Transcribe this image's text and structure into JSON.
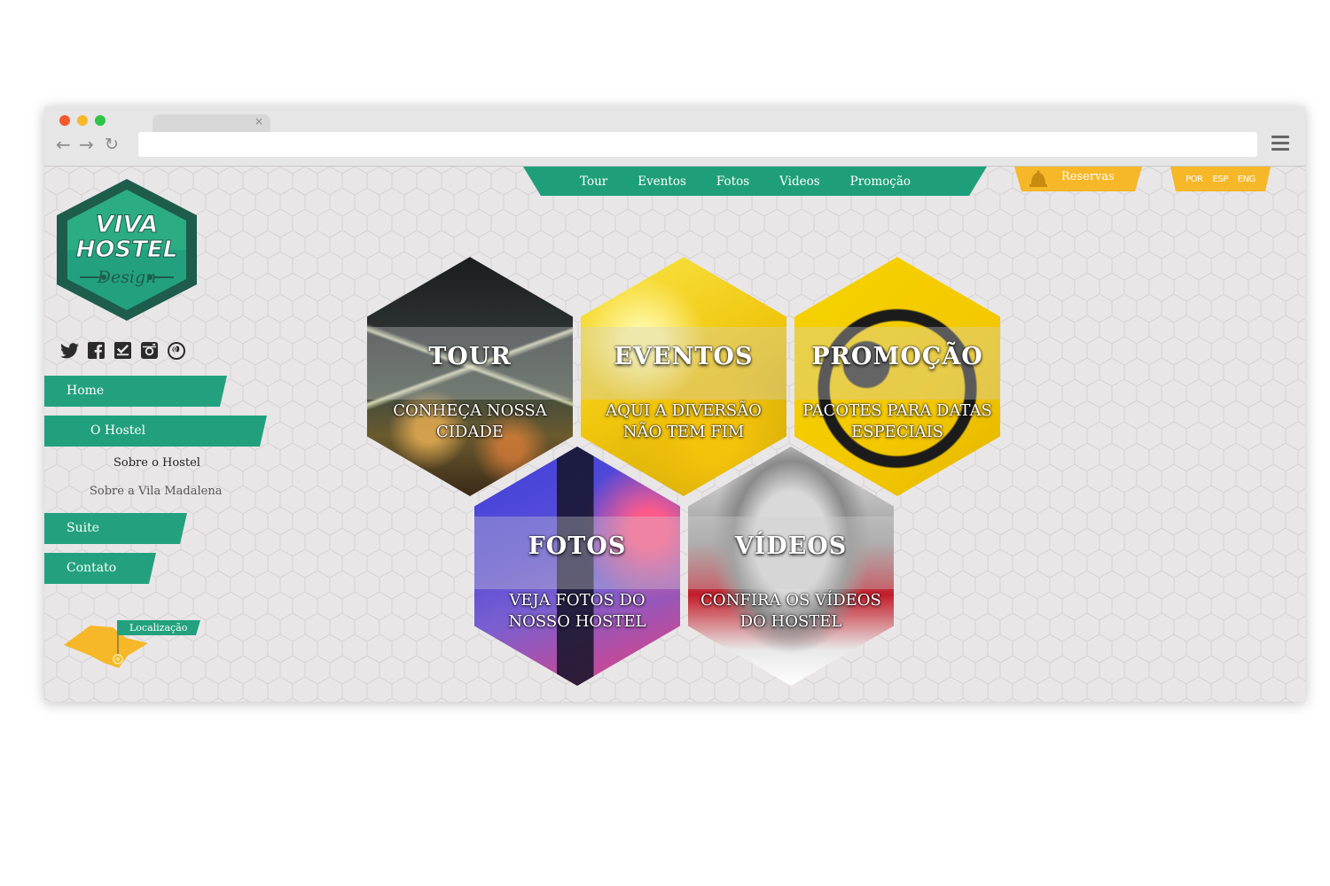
{
  "browser": {
    "tab_close": "×",
    "back": "←",
    "forward": "→",
    "reload": "↻",
    "url": ""
  },
  "logo": {
    "line1": "VIVA",
    "line2": "HOSTEL",
    "line3": "Design",
    "color_primary": "#23a17e",
    "color_dark": "#1e5c4c"
  },
  "social": [
    "twitter-icon",
    "facebook-icon",
    "foursquare-icon",
    "instagram-icon",
    "pinterest-icon"
  ],
  "sidebar": {
    "items": [
      {
        "label": "Home"
      },
      {
        "label": "O Hostel"
      },
      {
        "label": "Suite"
      },
      {
        "label": "Contato"
      }
    ],
    "subitems": [
      {
        "label": "Sobre o Hostel"
      },
      {
        "label": "Sobre a Vila Madalena"
      }
    ],
    "location_label": "Localização"
  },
  "topnav": {
    "items": [
      "Tour",
      "Eventos",
      "Fotos",
      "Videos",
      "Promoção"
    ],
    "color": "#1e9f7a"
  },
  "reservas": {
    "label": "Reservas",
    "color": "#f6b728"
  },
  "languages": [
    "POR",
    "ESP",
    "ENG"
  ],
  "tiles": [
    {
      "title": "TOUR",
      "subtitle": "CONHEÇA NOSSA CIDADE"
    },
    {
      "title": "EVENTOS",
      "subtitle": "AQUI A DIVERSÃO NÃO TEM FIM"
    },
    {
      "title": "PROMOÇÃO",
      "subtitle": "PACOTES  PARA DATAS ESPECIAIS"
    },
    {
      "title": "FOTOS",
      "subtitle": "VEJA FOTOS DO NOSSO HOSTEL"
    },
    {
      "title": "VÍDEOS",
      "subtitle": "CONFIRA OS VÍDEOS DO HOSTEL"
    }
  ]
}
